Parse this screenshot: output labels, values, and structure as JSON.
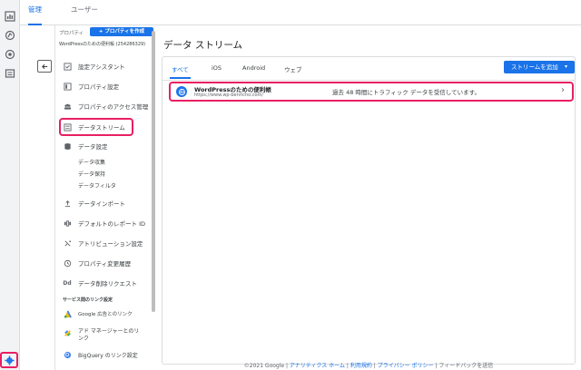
{
  "top_tabs": [
    "管理",
    "ユーザー"
  ],
  "property": {
    "label": "プロパティ",
    "create_button": "+ プロパティを作成",
    "name": "WordPressのための便利帳 (254286329)"
  },
  "nav": {
    "items": [
      "設定アシスタント",
      "プロパティ設定",
      "プロパティのアクセス管理",
      "データストリーム",
      "データ設定",
      "データインポート",
      "デフォルトのレポート ID",
      "アトリビューション設定",
      "プロパティ変更履歴",
      "データ削除リクエスト"
    ],
    "data_settings_sub": [
      "データ収集",
      "データ保持",
      "データフィルタ"
    ],
    "delete_icon_text": "Dd",
    "section_label": "サービス間のリンク設定",
    "link_items": [
      "Google 広告とのリンク",
      "アド マネージャーとのリンク",
      "BigQuery のリンク設定"
    ]
  },
  "main": {
    "title": "データ ストリーム",
    "tabs": [
      "すべて",
      "iOS",
      "Android",
      "ウェブ"
    ],
    "add_button": "ストリームを追加",
    "stream": {
      "name": "WordPressのための便利帳",
      "url": "https://www.wp-benricho.com/",
      "message": "過去 48 時間にトラフィック データを受信しています。"
    }
  },
  "footer": {
    "copyright": "©2021 Google | ",
    "links": [
      "アナリティクス ホーム",
      "利用規約",
      "プライバシー ポリシー"
    ],
    "feedback": "フィードバックを送信"
  },
  "colors": {
    "accent": "#1a73e8",
    "highlight": "#e91e63"
  }
}
